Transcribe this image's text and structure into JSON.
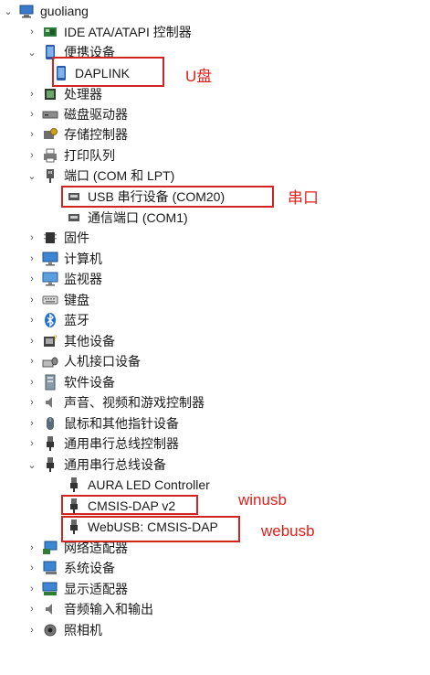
{
  "tree": {
    "root": "guoliang",
    "ide": "IDE ATA/ATAPI 控制器",
    "portable": "便携设备",
    "daplink": "DAPLINK",
    "processor": "处理器",
    "disk": "磁盘驱动器",
    "storage": "存储控制器",
    "print_queue": "打印队列",
    "ports": "端口 (COM 和 LPT)",
    "usb_serial": "USB 串行设备 (COM20)",
    "com1": "通信端口 (COM1)",
    "firmware": "固件",
    "computer": "计算机",
    "monitor": "监视器",
    "keyboard": "键盘",
    "bluetooth": "蓝牙",
    "other": "其他设备",
    "hid": "人机接口设备",
    "software": "软件设备",
    "sound": "声音、视频和游戏控制器",
    "mouse": "鼠标和其他指针设备",
    "usb_ctrl": "通用串行总线控制器",
    "usb_dev": "通用串行总线设备",
    "aura": "AURA LED Controller",
    "cmsis_v2": "CMSIS-DAP v2",
    "webusb": "WebUSB: CMSIS-DAP",
    "network": "网络适配器",
    "system": "系统设备",
    "display": "显示适配器",
    "audio_io": "音频输入和输出",
    "camera": "照相机"
  },
  "annotations": {
    "udisk": "U盘",
    "serial": "串口",
    "winusb": "winusb",
    "webusb": "webusb"
  },
  "colors": {
    "annotation": "#e0201b"
  }
}
